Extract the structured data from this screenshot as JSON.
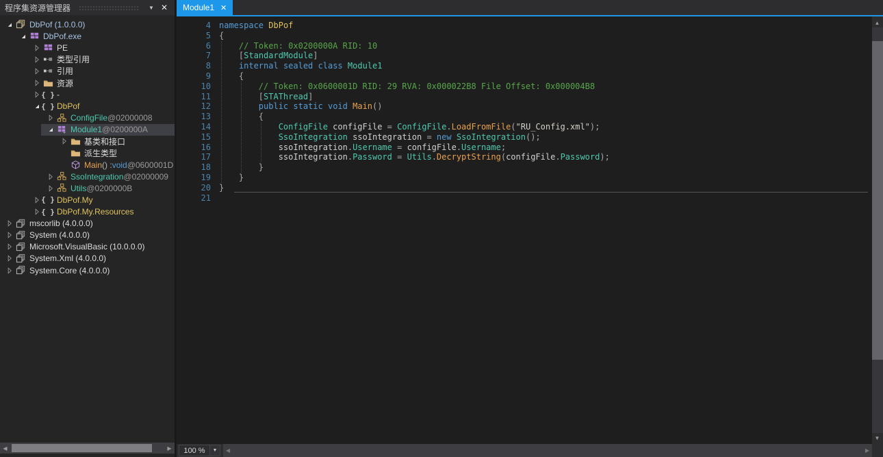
{
  "explorer": {
    "title": "程序集资源管理器",
    "items": [
      {
        "indent": 0,
        "expander": "open",
        "icon": "assembly-icon",
        "selected": false,
        "parts": [
          [
            "asm",
            "DbPof (1.0.0.0)"
          ]
        ]
      },
      {
        "indent": 1,
        "expander": "open",
        "icon": "module-icon",
        "selected": false,
        "parts": [
          [
            "asm",
            "DbPof.exe"
          ]
        ]
      },
      {
        "indent": 2,
        "expander": "closed",
        "icon": "pe-icon",
        "selected": false,
        "parts": [
          [
            "white",
            "PE"
          ]
        ]
      },
      {
        "indent": 2,
        "expander": "closed",
        "icon": "typeref-icon",
        "selected": false,
        "parts": [
          [
            "white",
            "类型引用"
          ]
        ]
      },
      {
        "indent": 2,
        "expander": "closed",
        "icon": "ref-icon",
        "selected": false,
        "parts": [
          [
            "white",
            "引用"
          ]
        ]
      },
      {
        "indent": 2,
        "expander": "closed",
        "icon": "folder-icon",
        "selected": false,
        "parts": [
          [
            "white",
            "资源"
          ]
        ]
      },
      {
        "indent": 2,
        "expander": "closed",
        "icon": "namespace-icon",
        "selected": false,
        "parts": [
          [
            "white",
            "-"
          ]
        ]
      },
      {
        "indent": 2,
        "expander": "open",
        "icon": "namespace-icon",
        "selected": false,
        "parts": [
          [
            "ns",
            "DbPof"
          ]
        ]
      },
      {
        "indent": 3,
        "expander": "closed",
        "icon": "class-icon",
        "selected": false,
        "parts": [
          [
            "type",
            "ConfigFile"
          ],
          [
            "tok",
            " @02000008"
          ]
        ]
      },
      {
        "indent": 3,
        "expander": "open",
        "icon": "module-class-icon",
        "selected": true,
        "parts": [
          [
            "type",
            "Module1"
          ],
          [
            "tok",
            " @0200000A"
          ]
        ]
      },
      {
        "indent": 4,
        "expander": "closed",
        "icon": "folder-icon",
        "selected": false,
        "parts": [
          [
            "white",
            "基类和接口"
          ]
        ]
      },
      {
        "indent": 4,
        "expander": "none",
        "icon": "folder-icon",
        "selected": false,
        "parts": [
          [
            "white",
            "派生类型"
          ]
        ]
      },
      {
        "indent": 4,
        "expander": "none",
        "icon": "method-icon",
        "selected": false,
        "parts": [
          [
            "me",
            "Main"
          ],
          [
            "pu",
            "() : "
          ],
          [
            "kw",
            "void"
          ],
          [
            "tok",
            " @0600001D"
          ]
        ]
      },
      {
        "indent": 3,
        "expander": "closed",
        "icon": "class-icon",
        "selected": false,
        "parts": [
          [
            "type",
            "SsoIntegration"
          ],
          [
            "tok",
            " @02000009"
          ]
        ]
      },
      {
        "indent": 3,
        "expander": "closed",
        "icon": "class-icon",
        "selected": false,
        "parts": [
          [
            "type",
            "Utils"
          ],
          [
            "tok",
            " @0200000B"
          ]
        ]
      },
      {
        "indent": 2,
        "expander": "closed",
        "icon": "namespace-icon",
        "selected": false,
        "parts": [
          [
            "ns",
            "DbPof.My"
          ]
        ]
      },
      {
        "indent": 2,
        "expander": "closed",
        "icon": "namespace-icon",
        "selected": false,
        "parts": [
          [
            "ns",
            "DbPof.My.Resources"
          ]
        ]
      },
      {
        "indent": 0,
        "expander": "closed",
        "icon": "assembly-gray-icon",
        "selected": false,
        "parts": [
          [
            "white",
            "mscorlib (4.0.0.0)"
          ]
        ]
      },
      {
        "indent": 0,
        "expander": "closed",
        "icon": "assembly-gray-icon",
        "selected": false,
        "parts": [
          [
            "white",
            "System (4.0.0.0)"
          ]
        ]
      },
      {
        "indent": 0,
        "expander": "closed",
        "icon": "assembly-gray-icon",
        "selected": false,
        "parts": [
          [
            "white",
            "Microsoft.VisualBasic (10.0.0.0)"
          ]
        ]
      },
      {
        "indent": 0,
        "expander": "closed",
        "icon": "assembly-gray-icon",
        "selected": false,
        "parts": [
          [
            "white",
            "System.Xml (4.0.0.0)"
          ]
        ]
      },
      {
        "indent": 0,
        "expander": "closed",
        "icon": "assembly-gray-icon",
        "selected": false,
        "parts": [
          [
            "white",
            "System.Core (4.0.0.0)"
          ]
        ]
      }
    ]
  },
  "tabs": [
    {
      "label": "Module1",
      "active": true
    }
  ],
  "editor": {
    "lines": [
      {
        "n": 4,
        "t": [
          [
            "kw",
            "namespace"
          ],
          [
            "pl",
            " "
          ],
          [
            "ns",
            "DbPof"
          ]
        ]
      },
      {
        "n": 5,
        "t": [
          [
            "pu",
            "{"
          ]
        ]
      },
      {
        "n": 6,
        "t": [
          [
            "pl",
            "    "
          ],
          [
            "cm",
            "// Token: 0x0200000A RID: 10"
          ]
        ]
      },
      {
        "n": 7,
        "t": [
          [
            "pl",
            "    "
          ],
          [
            "pu",
            "["
          ],
          [
            "ty",
            "StandardModule"
          ],
          [
            "pu",
            "]"
          ]
        ]
      },
      {
        "n": 8,
        "t": [
          [
            "pl",
            "    "
          ],
          [
            "kw",
            "internal"
          ],
          [
            "pl",
            " "
          ],
          [
            "kw",
            "sealed"
          ],
          [
            "pl",
            " "
          ],
          [
            "kw",
            "class"
          ],
          [
            "pl",
            " "
          ],
          [
            "ty",
            "Module1"
          ]
        ]
      },
      {
        "n": 9,
        "t": [
          [
            "pl",
            "    "
          ],
          [
            "pu",
            "{"
          ]
        ]
      },
      {
        "n": 10,
        "t": [
          [
            "pl",
            "        "
          ],
          [
            "cm",
            "// Token: 0x0600001D RID: 29 RVA: 0x000022B8 File Offset: 0x000004B8"
          ]
        ]
      },
      {
        "n": 11,
        "t": [
          [
            "pl",
            "        "
          ],
          [
            "pu",
            "["
          ],
          [
            "ty",
            "STAThread"
          ],
          [
            "pu",
            "]"
          ]
        ]
      },
      {
        "n": 12,
        "t": [
          [
            "pl",
            "        "
          ],
          [
            "kw",
            "public"
          ],
          [
            "pl",
            " "
          ],
          [
            "kw",
            "static"
          ],
          [
            "pl",
            " "
          ],
          [
            "kw",
            "void"
          ],
          [
            "pl",
            " "
          ],
          [
            "me",
            "Main"
          ],
          [
            "pu",
            "()"
          ]
        ]
      },
      {
        "n": 13,
        "t": [
          [
            "pl",
            "        "
          ],
          [
            "pu",
            "{"
          ]
        ]
      },
      {
        "n": 14,
        "t": [
          [
            "pl",
            "            "
          ],
          [
            "ty",
            "ConfigFile"
          ],
          [
            "pl",
            " configFile "
          ],
          [
            "pu",
            "= "
          ],
          [
            "ty",
            "ConfigFile"
          ],
          [
            "pu",
            "."
          ],
          [
            "me",
            "LoadFromFile"
          ],
          [
            "pu",
            "("
          ],
          [
            "st",
            "\"RU_Config.xml\""
          ],
          [
            "pu",
            ");"
          ]
        ]
      },
      {
        "n": 15,
        "t": [
          [
            "pl",
            "            "
          ],
          [
            "ty",
            "SsoIntegration"
          ],
          [
            "pl",
            " ssoIntegration "
          ],
          [
            "pu",
            "= "
          ],
          [
            "kw",
            "new"
          ],
          [
            "pl",
            " "
          ],
          [
            "ty",
            "SsoIntegration"
          ],
          [
            "pu",
            "();"
          ]
        ]
      },
      {
        "n": 16,
        "t": [
          [
            "pl",
            "            ssoIntegration"
          ],
          [
            "pu",
            "."
          ],
          [
            "ty",
            "Username"
          ],
          [
            "pu",
            " = "
          ],
          [
            "pl",
            "configFile"
          ],
          [
            "pu",
            "."
          ],
          [
            "ty",
            "Username"
          ],
          [
            "pu",
            ";"
          ]
        ]
      },
      {
        "n": 17,
        "t": [
          [
            "pl",
            "            ssoIntegration"
          ],
          [
            "pu",
            "."
          ],
          [
            "ty",
            "Password"
          ],
          [
            "pu",
            " = "
          ],
          [
            "ty",
            "Utils"
          ],
          [
            "pu",
            "."
          ],
          [
            "me",
            "DecryptString"
          ],
          [
            "pu",
            "("
          ],
          [
            "pl",
            "configFile"
          ],
          [
            "pu",
            "."
          ],
          [
            "ty",
            "Password"
          ],
          [
            "pu",
            ");"
          ]
        ]
      },
      {
        "n": 18,
        "t": [
          [
            "pl",
            "        "
          ],
          [
            "pu",
            "}"
          ]
        ]
      },
      {
        "n": 19,
        "t": [
          [
            "pl",
            "    "
          ],
          [
            "pu",
            "}"
          ]
        ]
      },
      {
        "n": 20,
        "t": [
          [
            "pu",
            "}"
          ]
        ]
      },
      {
        "n": 21,
        "t": []
      }
    ]
  },
  "statusbar": {
    "zoom": "100 %"
  },
  "colors": {
    "accent": "#1C97EA",
    "selection": "#3F3F46",
    "editor_bg": "#1E1E1E",
    "panel_bg": "#252526",
    "syntax": {
      "keyword": "#569CD6",
      "namespace": "#DFC35C",
      "comment": "#57A64A",
      "type": "#4EC9B0",
      "method": "#E8A14E",
      "plain": "#D0D0D0",
      "punctuation": "#ABABAB",
      "string": "#D6D0C8",
      "line_number": "#4B85AD"
    }
  }
}
